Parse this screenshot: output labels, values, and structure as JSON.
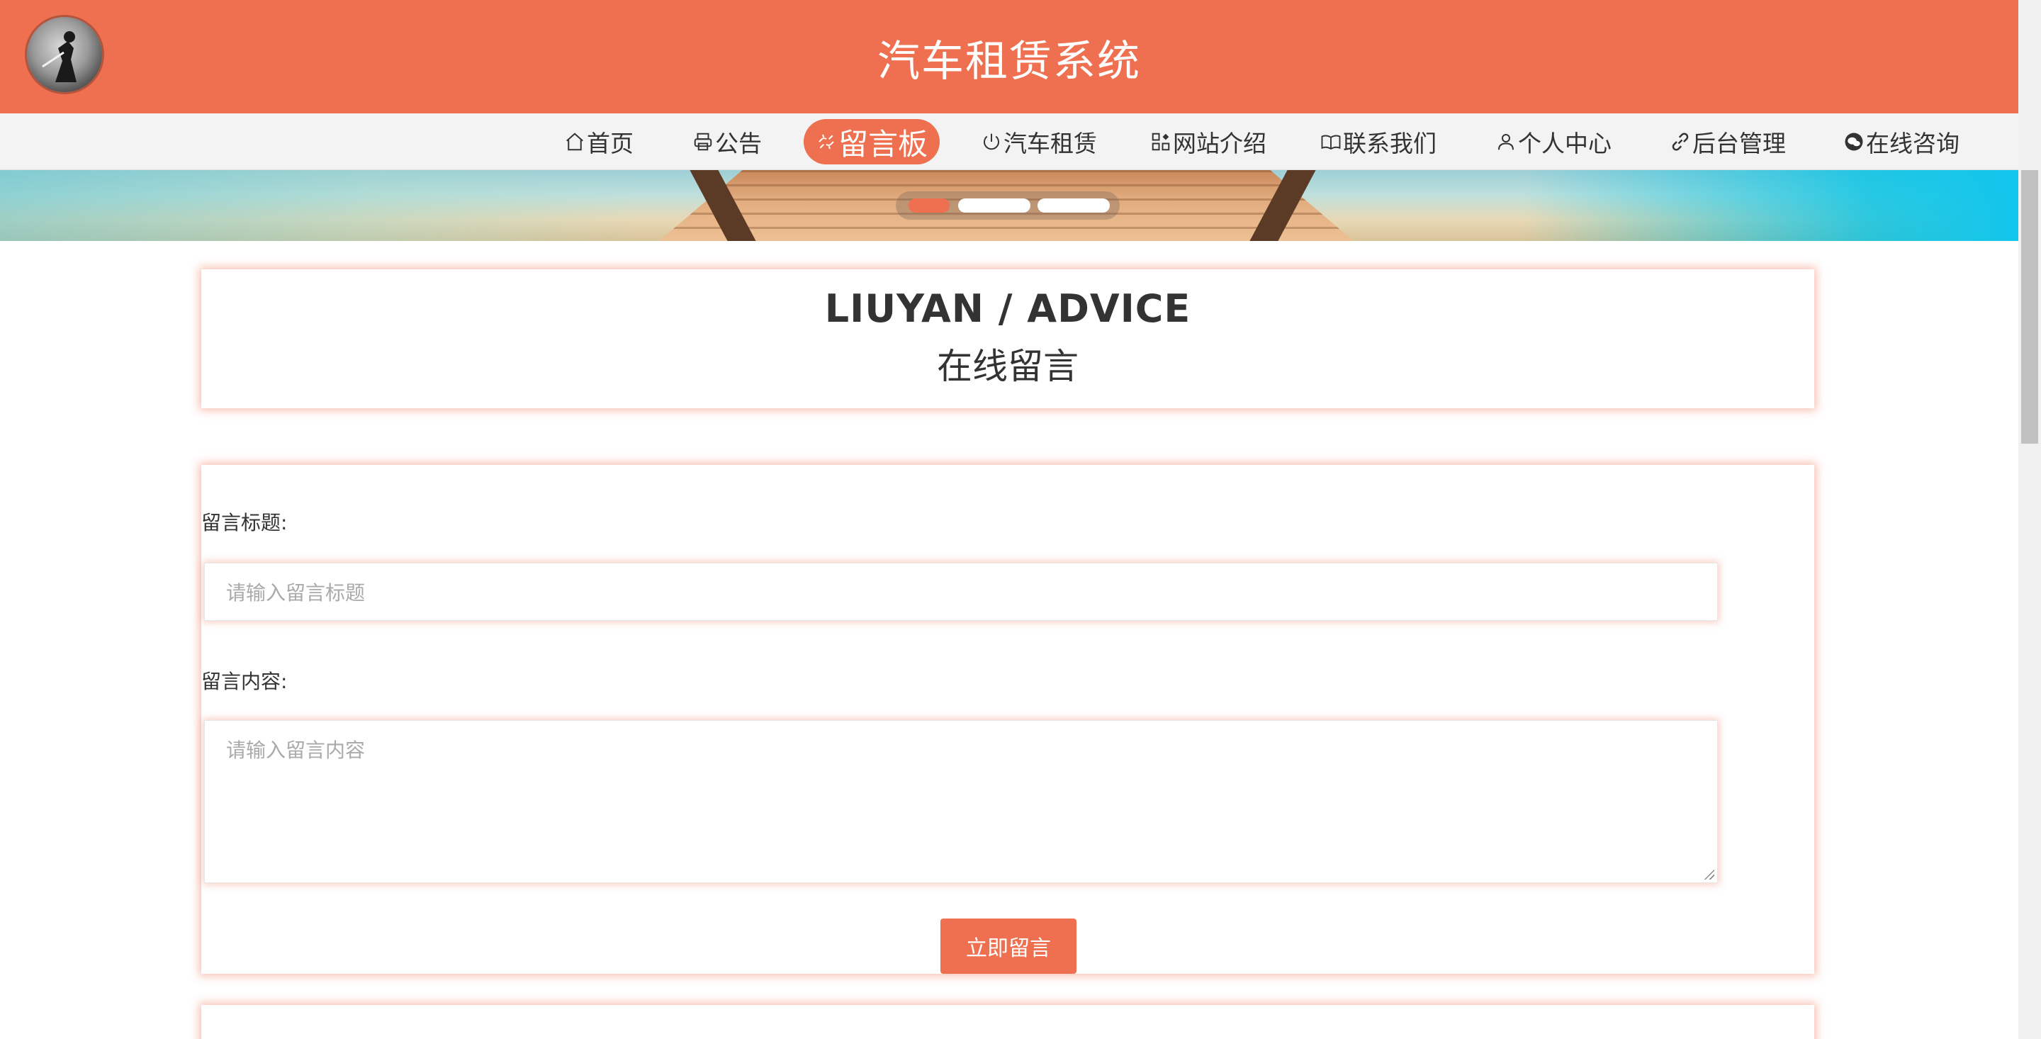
{
  "header": {
    "site_title": "汽车租赁系统",
    "logo_icon": "logo-avatar-icon"
  },
  "nav": {
    "items": [
      {
        "label": "首页",
        "icon": "home-icon"
      },
      {
        "label": "公告",
        "icon": "printer-icon"
      },
      {
        "label": "留言板",
        "icon": "link-broken-icon",
        "active": true
      },
      {
        "label": "汽车租赁",
        "icon": "power-icon"
      },
      {
        "label": "网站介绍",
        "icon": "apps-icon"
      },
      {
        "label": "联系我们",
        "icon": "book-open-icon"
      },
      {
        "label": "个人中心",
        "icon": "user-icon"
      },
      {
        "label": "后台管理",
        "icon": "link-icon"
      },
      {
        "label": "在线咨询",
        "icon": "wechat-icon"
      }
    ]
  },
  "banner": {
    "slides_count": 3,
    "active_slide": 1
  },
  "section": {
    "title_en": "LIUYAN / ADVICE",
    "title_cn": "在线留言"
  },
  "form": {
    "title_label": "留言标题:",
    "title_placeholder": "请输入留言标题",
    "content_label": "留言内容:",
    "content_placeholder": "请输入留言内容",
    "submit_label": "立即留言"
  },
  "colors": {
    "accent": "#ef7050",
    "nav_bg": "#f3f3f3",
    "text": "#333333"
  }
}
